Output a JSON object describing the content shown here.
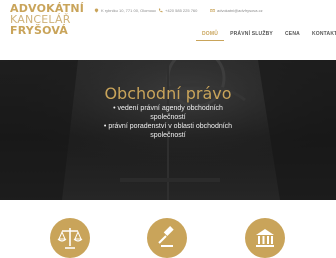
{
  "logo": {
    "line1": "ADVOKÁTNÍ",
    "line2": "KANCELÁŘ",
    "line3": "FRYŠOVÁ"
  },
  "contact": {
    "address": "K rybníku 10, 771 00, Olomouc",
    "phone": "+420 585 225 760",
    "email": "advokatni@advfrysova.cz"
  },
  "nav": {
    "items": [
      "DOMŮ",
      "PRÁVNÍ SLUŽBY",
      "CENA",
      "KONTAKT"
    ],
    "active": "DOMŮ"
  },
  "hero": {
    "title": "Obchodní právo",
    "bullets": [
      "• vedení právní agendy obchodních společností",
      "• právní poradenství v oblasti obchodních společností"
    ]
  },
  "features": {
    "icons": [
      "scales-icon",
      "gavel-icon",
      "courthouse-icon"
    ]
  },
  "colors": {
    "accent": "#c9a45a",
    "hero_bg": "#1f1f1f",
    "text_light": "#f2f2f2"
  }
}
